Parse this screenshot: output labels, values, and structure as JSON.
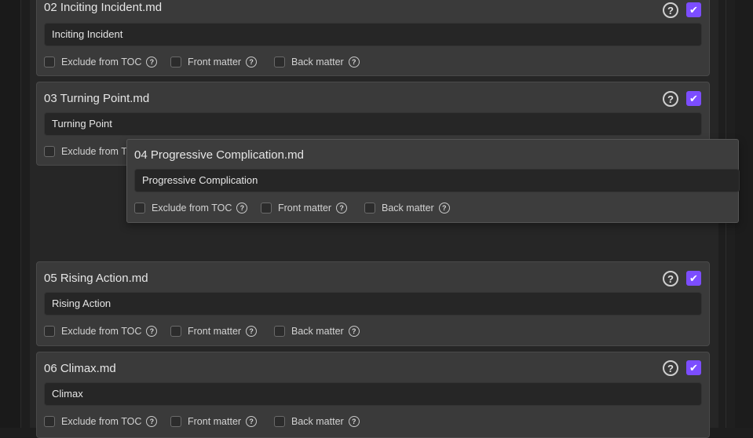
{
  "accent_color": "#7c4dff",
  "cards": [
    {
      "filename": "02 Inciting Incident.md",
      "title_value": "Inciting Incident",
      "exclude_label": "Exclude from TOC",
      "front_label": "Front matter",
      "back_label": "Back matter",
      "help_glyph": "?",
      "included": true
    },
    {
      "filename": "03 Turning Point.md",
      "title_value": "Turning Point",
      "exclude_label": "Exclude from TOC",
      "front_label": "Front matter",
      "back_label": "Back matter",
      "help_glyph": "?",
      "included": true
    },
    {
      "filename": "05 Rising Action.md",
      "title_value": "Rising Action",
      "exclude_label": "Exclude from TOC",
      "front_label": "Front matter",
      "back_label": "Back matter",
      "help_glyph": "?",
      "included": true
    },
    {
      "filename": "06 Climax.md",
      "title_value": "Climax",
      "exclude_label": "Exclude from TOC",
      "front_label": "Front matter",
      "back_label": "Back matter",
      "help_glyph": "?",
      "included": true
    }
  ],
  "dragged_card": {
    "filename": "04 Progressive Complication.md",
    "title_value": "Progressive Complication",
    "exclude_label": "Exclude from TOC",
    "front_label": "Front matter",
    "back_label": "Back matter",
    "help_glyph": "?"
  },
  "checkmark_glyph": "✔"
}
